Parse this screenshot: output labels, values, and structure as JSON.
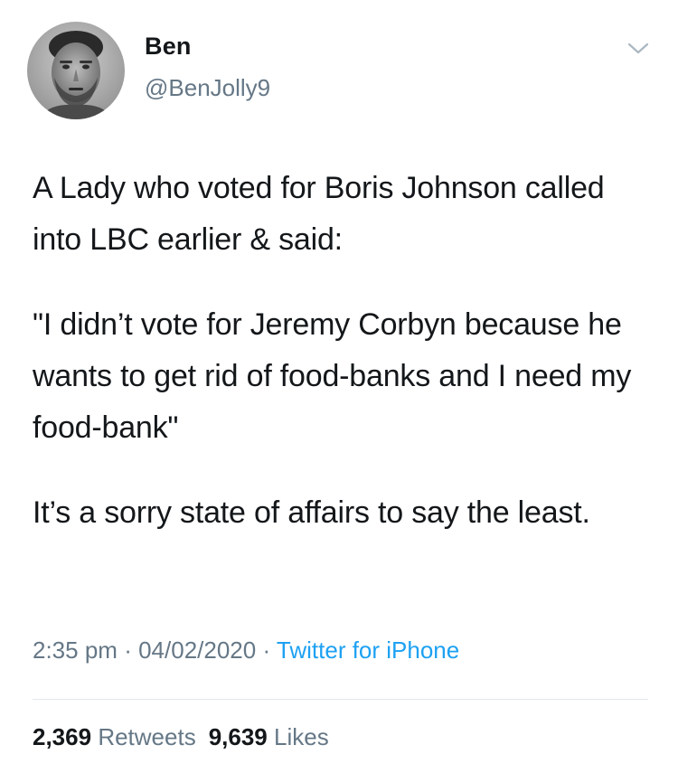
{
  "author": {
    "display_name": "Ben",
    "handle": "@BenJolly9"
  },
  "icons": {
    "avatar": "profile-photo",
    "menu": "chevron-down-icon"
  },
  "tweet": {
    "paragraphs": [
      "A Lady who voted for Boris Johnson called into LBC earlier & said:",
      "\"I didn’t vote for Jeremy Corbyn because he wants to get rid of food-banks and I need my food-bank\"",
      "It’s a sorry state of affairs to say the least."
    ]
  },
  "meta": {
    "time": "2:35 pm",
    "separator": "·",
    "date": "04/02/2020",
    "source": "Twitter for iPhone"
  },
  "stats": {
    "retweets_count": "2,369",
    "retweets_label": "Retweets",
    "likes_count": "9,639",
    "likes_label": "Likes"
  },
  "colors": {
    "text": "#14171a",
    "secondary": "#657786",
    "link": "#1da1f2",
    "divider": "#e1e8ed"
  }
}
